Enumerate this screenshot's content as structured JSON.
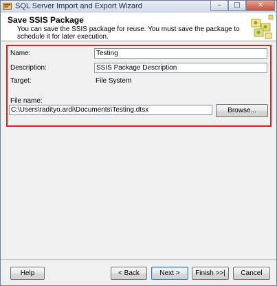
{
  "window": {
    "title": "SQL Server Import and Export Wizard",
    "caption_buttons": {
      "minimize": "–",
      "maximize": "□",
      "close": "✕"
    }
  },
  "header": {
    "title": "Save SSIS Package",
    "subtitle": "You can save the SSIS package for reuse. You must save the package to schedule it for later execution."
  },
  "form": {
    "name_label": "Name:",
    "name_value": "Testing",
    "description_label": "Description:",
    "description_value": "SSIS Package Description",
    "target_label": "Target:",
    "target_value": "File System",
    "file_name_label": "File name:",
    "file_name_value": "C:\\Users\\radityo.ardi\\Documents\\Testing.dtsx",
    "browse_label": "Browse..."
  },
  "footer": {
    "help_label": "Help",
    "back_label": "< Back",
    "next_label": "Next >",
    "finish_label": "Finish >>|",
    "cancel_label": "Cancel"
  },
  "colors": {
    "highlight_border": "#e0201c",
    "dialog_background": "#f0f0f0"
  }
}
